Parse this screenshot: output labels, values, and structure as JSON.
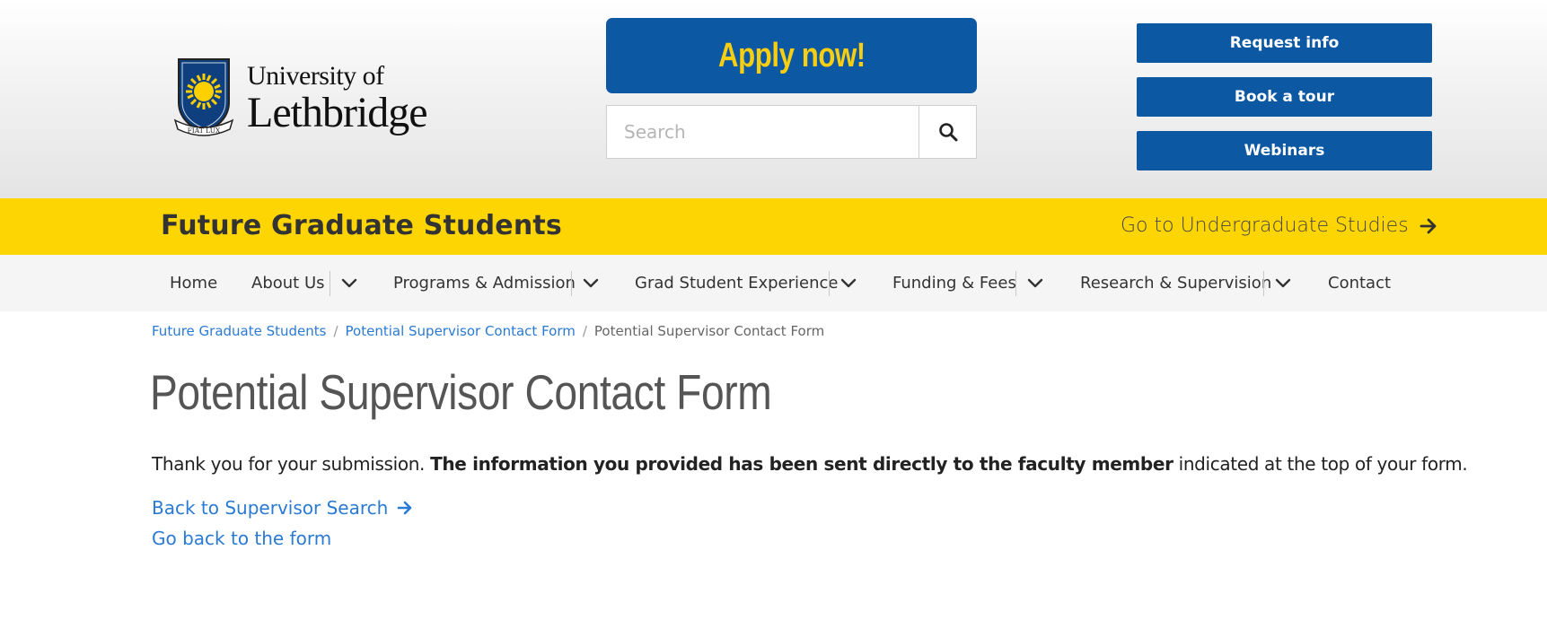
{
  "header": {
    "logo": {
      "line1": "University of",
      "line2": "Lethbridge",
      "motto": "FIAT LUX"
    },
    "apply_label": "Apply now!",
    "search_placeholder": "Search",
    "buttons": {
      "request_info": "Request info",
      "book_tour": "Book a tour",
      "webinars": "Webinars"
    }
  },
  "section_bar": {
    "title": "Future Graduate Students",
    "undergrad_link": "Go to Undergraduate Studies"
  },
  "nav": {
    "items": [
      {
        "label": "Home"
      },
      {
        "label": "About Us"
      },
      {
        "label": "Programs & Admission"
      },
      {
        "label": "Grad Student Experience"
      },
      {
        "label": "Funding & Fees"
      },
      {
        "label": "Research & Supervision"
      },
      {
        "label": "Contact"
      }
    ]
  },
  "breadcrumb": {
    "items": [
      "Future Graduate Students",
      "Potential Supervisor Contact Form"
    ],
    "separator": "/",
    "current": "Potential Supervisor Contact Form"
  },
  "main": {
    "title": "Potential Supervisor Contact Form",
    "thanks_prefix": "Thank you for your submission. ",
    "thanks_bold": "The information you provided has been sent directly to the faculty member",
    "thanks_suffix": " indicated at the top of your form.",
    "back_link": "Back to Supervisor Search",
    "form_link": "Go back to the form"
  },
  "colors": {
    "brand_blue": "#0c58a3",
    "brand_yellow": "#fdd502",
    "apply_text": "#f7ce11",
    "link_blue": "#2a7ad3"
  },
  "icons": [
    "crest-logo",
    "search-icon",
    "arrow-right-icon",
    "chevron-down-icon"
  ]
}
